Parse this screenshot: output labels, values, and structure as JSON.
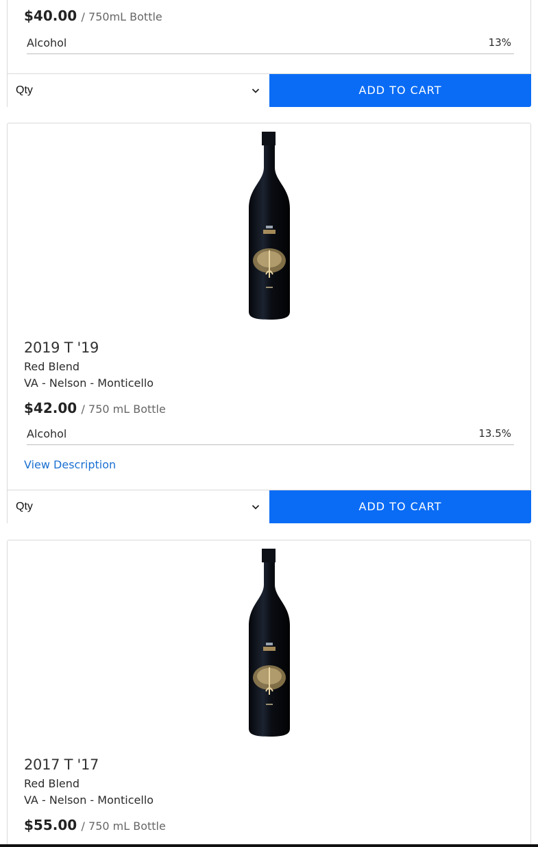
{
  "products": [
    {
      "price": "$40.00",
      "unit": "/ 750mL Bottle",
      "spec_label": "Alcohol",
      "spec_value": "13%",
      "qty_label": "Qty",
      "cart_label": "ADD TO CART"
    },
    {
      "title": "2019 T '19",
      "varietal": "Red Blend",
      "region": "VA - Nelson - Monticello",
      "price": "$42.00",
      "unit": "/ 750 mL Bottle",
      "spec_label": "Alcohol",
      "spec_value": "13.5%",
      "link_label": "View Description",
      "qty_label": "Qty",
      "cart_label": "ADD TO CART"
    },
    {
      "title": "2017 T '17",
      "varietal": "Red Blend",
      "region": "VA - Nelson - Monticello",
      "price": "$55.00",
      "unit": "/ 750 mL Bottle"
    }
  ],
  "icons": {
    "chevron": "chevron-down-icon",
    "bottle": "wine-bottle-image"
  },
  "colors": {
    "accent": "#0a6cf5",
    "link": "#1a6fd1"
  }
}
